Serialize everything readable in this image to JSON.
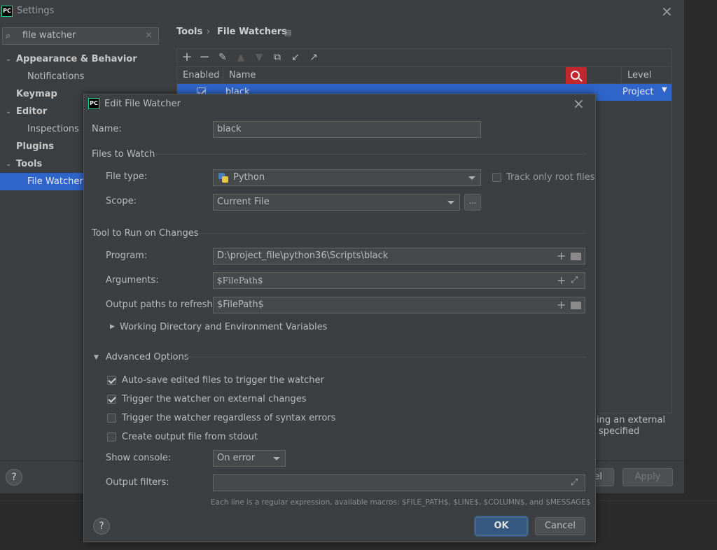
{
  "settings": {
    "title": "Settings",
    "search": {
      "value": "file watcher"
    },
    "sidebar": [
      {
        "label": "Appearance & Behavior",
        "type": "group",
        "expanded": true
      },
      {
        "label": "Notifications",
        "type": "child"
      },
      {
        "label": "Keymap",
        "type": "group"
      },
      {
        "label": "Editor",
        "type": "group",
        "expanded": true
      },
      {
        "label": "Inspections",
        "type": "child"
      },
      {
        "label": "Plugins",
        "type": "group"
      },
      {
        "label": "Tools",
        "type": "group",
        "expanded": true
      },
      {
        "label": "File Watchers",
        "type": "child",
        "selected": true
      }
    ],
    "breadcrumb": {
      "root": "Tools",
      "separator": "›",
      "current": "File Watchers"
    },
    "table": {
      "columns": [
        "Enabled",
        "Name",
        "Level"
      ],
      "rows": [
        {
          "enabled": true,
          "name": "black",
          "level": "Project"
        }
      ]
    },
    "hint_line1": "ing an external",
    "hint_line2": "specified",
    "cancel_partial": "el",
    "apply_label": "Apply",
    "help_label": "?"
  },
  "dialog": {
    "title": "Edit File Watcher",
    "name_label": "Name:",
    "name_value": "black",
    "files_to_watch": "Files to Watch",
    "file_type_label": "File type:",
    "file_type_value": "Python",
    "track_root_label": "Track only root files",
    "track_root_checked": false,
    "scope_label": "Scope:",
    "scope_value": "Current File",
    "scope_more": "...",
    "tool_section": "Tool to Run on Changes",
    "program_label": "Program:",
    "program_value": "D:\\project_file\\python36\\Scripts\\black",
    "arguments_label": "Arguments:",
    "arguments_value": "$FilePath$",
    "output_paths_label": "Output paths to refresh:",
    "output_paths_value": "$FilePath$",
    "working_dir_label": "Working Directory and Environment Variables",
    "advanced_label": "Advanced Options",
    "options": [
      {
        "label": "Auto-save edited files to trigger the watcher",
        "checked": true
      },
      {
        "label": "Trigger the watcher on external changes",
        "checked": true
      },
      {
        "label": "Trigger the watcher regardless of syntax errors",
        "checked": false
      },
      {
        "label": "Create output file from stdout",
        "checked": false
      }
    ],
    "show_console_label": "Show console:",
    "show_console_value": "On error",
    "output_filters_label": "Output filters:",
    "output_filters_value": "",
    "filters_hint": "Each line is a regular expression, available macros: $FILE_PATH$, $LINE$, $COLUMN$, and $MESSAGE$",
    "ok_label": "OK",
    "cancel_label": "Cancel",
    "help_label": "?"
  },
  "icons": {
    "app_logo": "PC",
    "close": "×",
    "plus": "+",
    "browse": "folder-icon",
    "expand": "expand-icon"
  },
  "colors": {
    "selection": "#2f65ca",
    "accent_ok": "#365880",
    "search_highlight": "#c1272d"
  }
}
